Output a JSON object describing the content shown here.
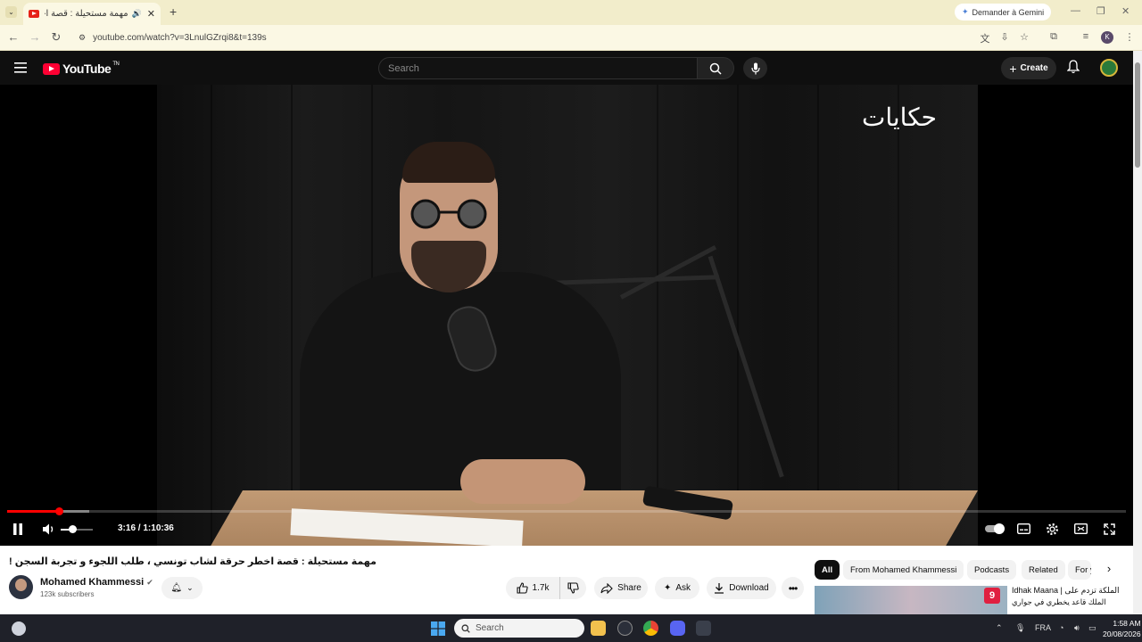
{
  "browser": {
    "tab_title": "مهمة مستحيلة : قصة اخطر",
    "url": "youtube.com/watch?v=3LnulGZrqi8&t=139s",
    "gemini_label": "Demander à Gemini",
    "profile_initial": "K"
  },
  "youtube": {
    "logo_text": "YouTube",
    "logo_suffix": "TN",
    "search_placeholder": "Search",
    "create_label": "Create"
  },
  "player": {
    "watermark": "حكايات",
    "time_current": "3:16",
    "time_separator": " / ",
    "time_total": "1:10:36",
    "progress_fraction": 0.0464,
    "buffered_fraction": 0.073,
    "volume_fraction": 0.35,
    "progress_color": "#ff0000"
  },
  "video": {
    "title": "مهمة مستحيلة : قصة اخطر حرقة لشاب تونسي ، طلب اللجوء و تجربة السجن !",
    "channel_name": "Mohamed Khammessi",
    "subscribers": "123k subscribers",
    "likes": "1.7k",
    "share_label": "Share",
    "ask_label": "Ask",
    "download_label": "Download"
  },
  "chips": [
    "All",
    "From Mohamed Khammessi",
    "Podcasts",
    "Related",
    "For y"
  ],
  "recommended": {
    "badge": "9",
    "title_line1": "Idhak Maana |",
    "title_line1_ar": "الملكة تزدم على",
    "title_line2": "الملك قاعد يخطري في جواري"
  },
  "taskbar": {
    "search_label": "Search",
    "language": "FRA",
    "time": "1:58 AM",
    "date": "20/08/2026"
  },
  "colors": {
    "youtube_red": "#ff0033",
    "browser_chrome": "#f2edcb",
    "taskbar": "#1f2129"
  }
}
